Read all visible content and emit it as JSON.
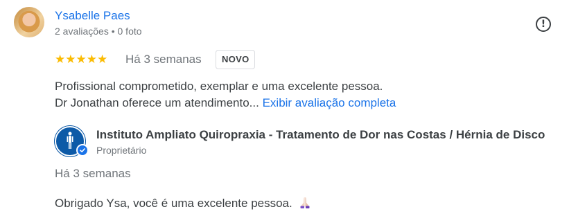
{
  "review": {
    "reviewer_name": "Ysabelle Paes",
    "reviewer_meta": "2 avaliações • 0 foto",
    "stars": "★★★★★",
    "date": "Há 3 semanas",
    "badge": "NOVO",
    "text_line1": "Profissional comprometido, exemplar e uma excelente pessoa.",
    "text_line2": "Dr Jonathan oferece um atendimento...",
    "more_link": "Exibir avaliação completa"
  },
  "owner_response": {
    "name": "Instituto Ampliato Quiropraxia - Tratamento de Dor nas Costas / Hérnia de Disco",
    "role": "Proprietário",
    "date": "Há 3 semanas",
    "text": "Obrigado Ysa, você é uma excelente pessoa."
  },
  "icons": {
    "flag": "report-icon",
    "verified": "verified-check-icon",
    "emoji": "praying-hands-icon"
  },
  "colors": {
    "link": "#1a73e8",
    "star": "#fbbc04",
    "owner_brand": "#0d5aa7"
  }
}
